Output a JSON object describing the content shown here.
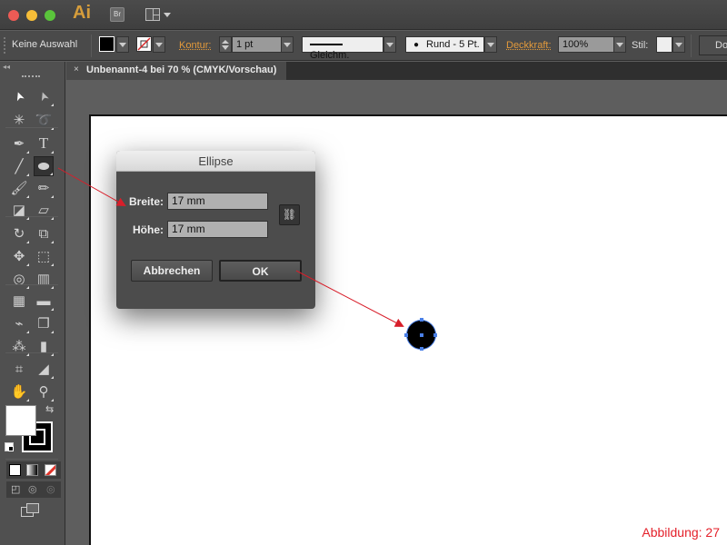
{
  "window": {
    "app_logo": "Ai",
    "bridge_label": "Br",
    "traffic_lights": {
      "close": "#ee5b55",
      "minimize": "#f6bd38",
      "zoom": "#5ac43b"
    }
  },
  "control_bar": {
    "selection_status": "Keine Auswahl",
    "fill_color": "#000000",
    "stroke_color": "none",
    "stroke_label": "Kontur:",
    "stroke_weight": "1 pt",
    "stroke_style": "Gleichm.",
    "brush": "Rund - 5 Pt.",
    "opacity_label": "Deckkraft:",
    "opacity_value": "100%",
    "style_label": "Stil:",
    "doc_setup_partial": "Do"
  },
  "document_tab": {
    "title": "Unbenannt-4 bei 70 % (CMYK/Vorschau)",
    "close_glyph": "×"
  },
  "tools": {
    "rows": [
      [
        "selection-tool",
        "direct-selection-tool"
      ],
      [
        "magic-wand-tool",
        "lasso-tool"
      ],
      [
        "pen-tool",
        "type-tool"
      ],
      [
        "line-segment-tool",
        "ellipse-tool"
      ],
      [
        "paintbrush-tool",
        "pencil-tool"
      ],
      [
        "blob-brush-tool",
        "eraser-tool"
      ],
      [
        "rotate-tool",
        "scale-tool"
      ],
      [
        "puppet-warp-tool",
        "free-transform-tool"
      ],
      [
        "shape-builder-tool",
        "perspective-grid-tool"
      ],
      [
        "mesh-tool",
        "gradient-tool"
      ],
      [
        "eyedropper-tool",
        "blend-tool"
      ],
      [
        "symbol-sprayer-tool",
        "column-graph-tool"
      ],
      [
        "artboard-tool",
        "slice-tool"
      ],
      [
        "hand-tool",
        "zoom-tool"
      ]
    ],
    "active_tool": "ellipse-tool",
    "type_glyph": "T",
    "fill_swatch": "#ffffff",
    "stroke_swatch": "#000000"
  },
  "dialog": {
    "title": "Ellipse",
    "width_label": "Breite:",
    "width_value": "17 mm",
    "height_label": "Höhe:",
    "height_value": "17 mm",
    "cancel_label": "Abbrechen",
    "ok_label": "OK"
  },
  "figure_label": "Abbildung: 27",
  "annotation_color": "#d81e2a"
}
